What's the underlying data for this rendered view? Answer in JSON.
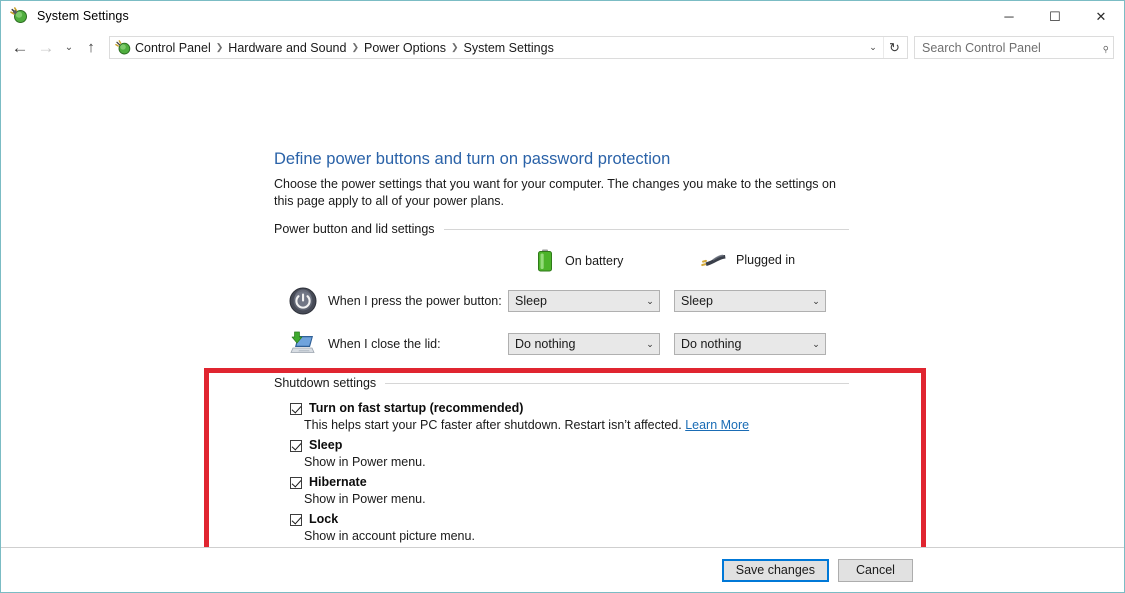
{
  "window": {
    "title": "System Settings",
    "title_icon": "power-plug-icon",
    "minimize": "─",
    "maximize": "☐",
    "close": "✕"
  },
  "nav": {
    "back_icon": "←",
    "forward_icon": "→",
    "recent_icon": "⌄",
    "up_icon": "↑",
    "address_icon": "power-plug-icon",
    "breadcrumbs": [
      "Control Panel",
      "Hardware and Sound",
      "Power Options",
      "System Settings"
    ],
    "separator": "❯",
    "dropdown_icon": "⌄",
    "refresh_icon": "↻"
  },
  "search": {
    "placeholder": "Search Control Panel",
    "value": "",
    "icon": "⌕"
  },
  "page": {
    "title": "Define power buttons and turn on password protection",
    "description": "Choose the power settings that you want for your computer. The changes you make to the settings on this page apply to all of your power plans."
  },
  "power_section": {
    "group_label": "Power button and lid settings",
    "columns": [
      {
        "label": "On battery",
        "icon": "battery-icon"
      },
      {
        "label": "Plugged in",
        "icon": "power-plug-icon"
      }
    ],
    "rows": [
      {
        "icon": "power-button-icon",
        "label": "When I press the power button:",
        "on_battery": "Sleep",
        "plugged_in": "Sleep",
        "arrow": "⌄"
      },
      {
        "icon": "laptop-lid-icon",
        "label": "When I close the lid:",
        "on_battery": "Do nothing",
        "plugged_in": "Do nothing",
        "arrow": "⌄"
      }
    ]
  },
  "shutdown_section": {
    "group_label": "Shutdown settings",
    "highlight_color": "#e02530",
    "items": [
      {
        "label": "Turn on fast startup (recommended)",
        "checked": true,
        "description": "This helps start your PC faster after shutdown. Restart isn’t affected.",
        "link": "Learn More"
      },
      {
        "label": "Sleep",
        "checked": true,
        "description": "Show in Power menu.",
        "link": ""
      },
      {
        "label": "Hibernate",
        "checked": true,
        "description": "Show in Power menu.",
        "link": ""
      },
      {
        "label": "Lock",
        "checked": true,
        "description": "Show in account picture menu.",
        "link": ""
      }
    ]
  },
  "footer": {
    "save_label": "Save changes",
    "cancel_label": "Cancel"
  }
}
